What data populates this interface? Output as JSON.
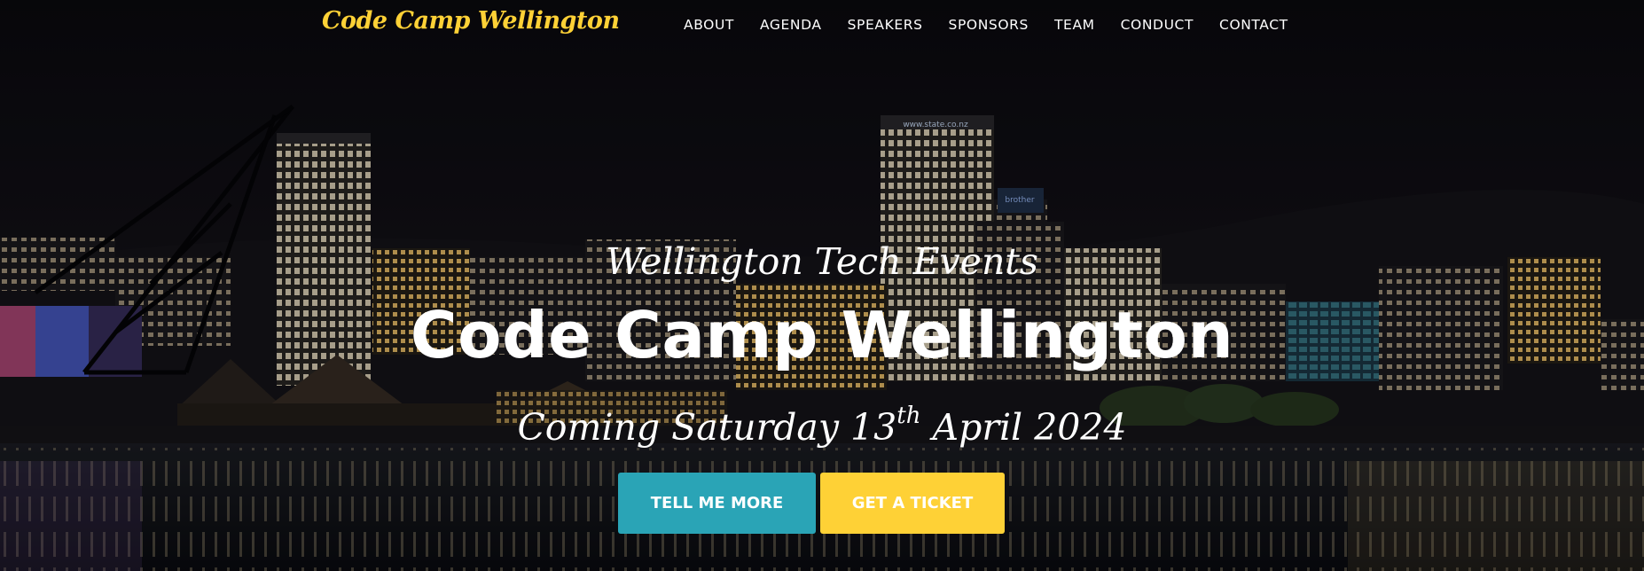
{
  "nav": {
    "brand": "Code Camp Wellington",
    "items": [
      "ABOUT",
      "AGENDA",
      "SPEAKERS",
      "SPONSORS",
      "TEAM",
      "CONDUCT",
      "CONTACT"
    ]
  },
  "hero": {
    "lead": "Wellington Tech Events",
    "title": "Code Camp Wellington",
    "date_prefix": "Coming Saturday 13",
    "date_sup": "th",
    "date_suffix": " April 2024",
    "buttons": {
      "more": "TELL ME MORE",
      "ticket": "GET A TICKET"
    },
    "background_signs": {
      "tower": "www.state.co.nz",
      "brand": "brother"
    }
  },
  "colors": {
    "accent_yellow": "#fed136",
    "accent_teal": "#2aa4b6",
    "text": "#ffffff",
    "sky": "#0e0d12"
  }
}
